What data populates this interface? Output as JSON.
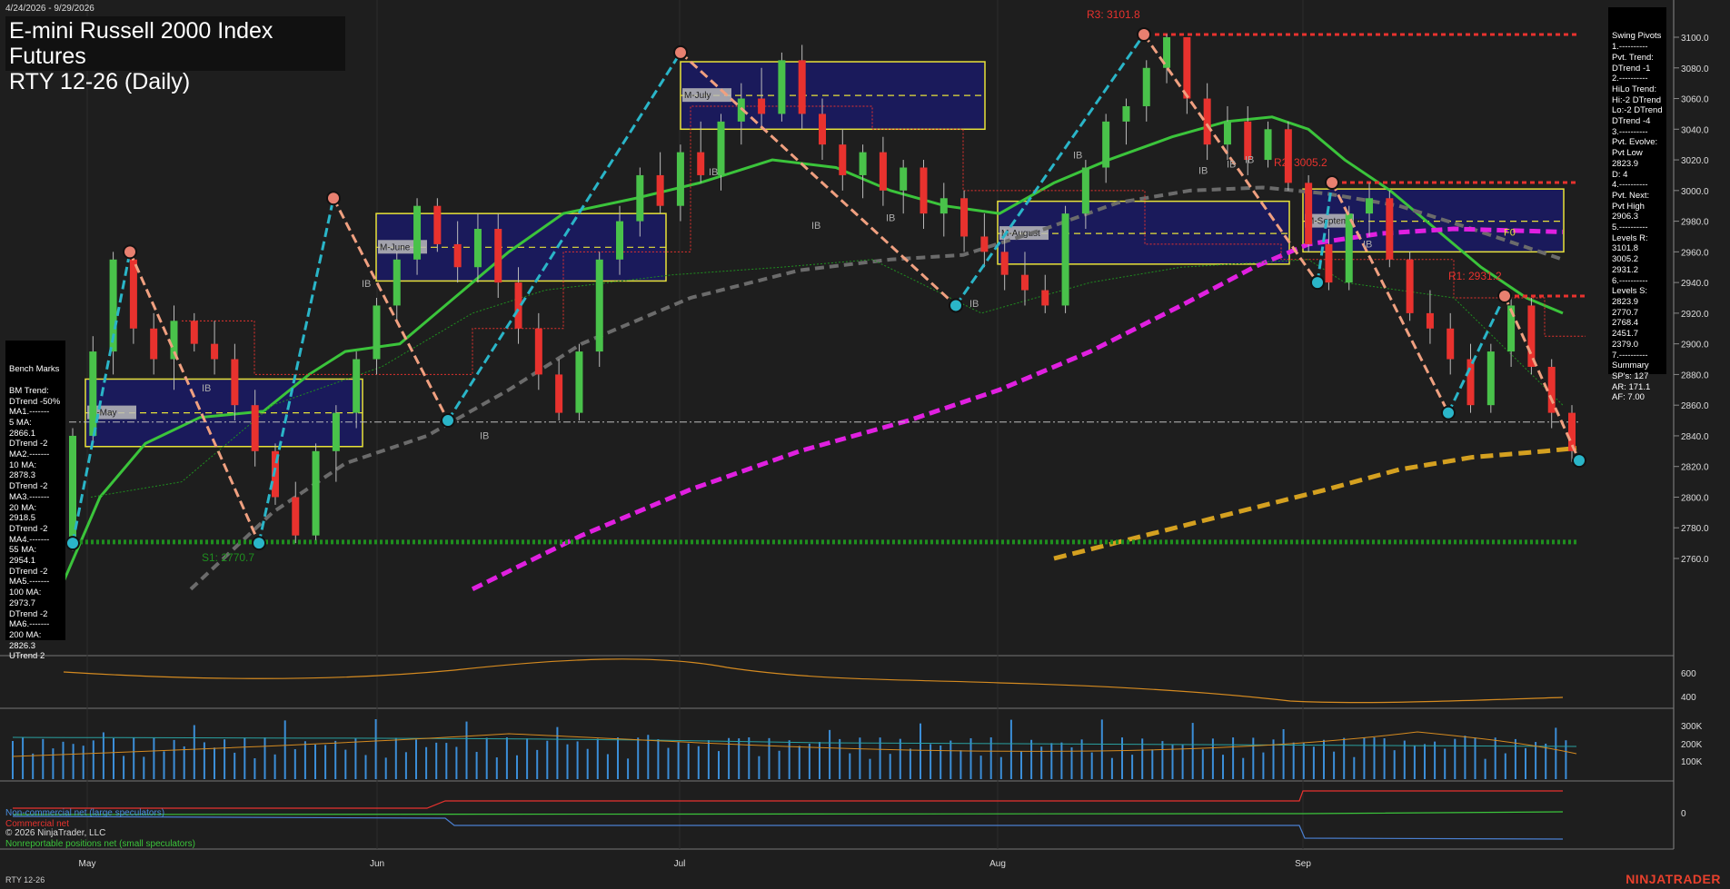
{
  "date_range": "4/24/2026 - 9/29/2026",
  "title": "E-mini Russell 2000 Index Futures",
  "subtitle": "RTY 12-26 (Daily)",
  "right_panel": {
    "lines": [
      "Swing Pivots",
      "1.----------",
      "Pvt. Trend:",
      "DTrend -1",
      "2.----------",
      "HiLo Trend:",
      "Hi:-2 DTrend",
      "Lo:-2 DTrend",
      "DTrend -4",
      "3.----------",
      "Pvt. Evolve:",
      "Pvt Low",
      "2823.9",
      "D: 4",
      "4.----------",
      "Pvt. Next:",
      "Pvt High",
      "2906.3",
      "5.----------",
      "Levels R:",
      "3101.8",
      "3005.2",
      "2931.2",
      "6.----------",
      "Levels S:",
      "2823.9",
      "2770.7",
      "2768.4",
      "2451.7",
      "2379.0",
      "7.----------",
      "Summary",
      "SP's: 127",
      "AR: 171.1",
      "AF: 7.00"
    ]
  },
  "left_panel": {
    "lines": [
      "Bench Marks",
      "",
      "BM Trend:",
      "DTrend -50%",
      "MA1.-------",
      "5 MA:",
      "2866.1",
      "DTrend -2",
      "MA2.-------",
      "10 MA:",
      "2878.3",
      "DTrend -2",
      "MA3.-------",
      "20 MA:",
      "2918.5",
      "DTrend -2",
      "MA4.-------",
      "55 MA:",
      "2954.1",
      "DTrend -2",
      "MA5.-------",
      "100 MA:",
      "2973.7",
      "DTrend -2",
      "MA6.-------",
      "200 MA:",
      "2826.3",
      "UTrend 2"
    ]
  },
  "levels": {
    "r3": "R3: 3101.8",
    "r2": "R2: 3005.2",
    "r1": "R1: 2931.2",
    "s1": "S1: 2770.7"
  },
  "box_labels": [
    "M-May",
    "M-June",
    "M-July",
    "M-August",
    "M-September"
  ],
  "ib_label": "IB",
  "fib_label": "F0",
  "x_labels": [
    "May",
    "Jun",
    "Jul",
    "Aug",
    "Sep"
  ],
  "y_ticks": [
    "3100.0",
    "3080.0",
    "3060.0",
    "3040.0",
    "3020.0",
    "3000.0",
    "2980.0",
    "2960.0",
    "2940.0",
    "2920.0",
    "2900.0",
    "2880.0",
    "2860.0",
    "2840.0",
    "2820.0",
    "2800.0",
    "2780.0",
    "2760.0"
  ],
  "osc_ticks": [
    "600",
    "400"
  ],
  "vol_ticks": [
    "300K",
    "200K",
    "100K"
  ],
  "cot_ticks": [
    "0"
  ],
  "cot_legend": {
    "noncommercial": "Non-commercial net (large speculators)",
    "commercial": "Commercial net",
    "nonreportable": "Nonreportable positions net (small speculators)"
  },
  "copyright": "© 2026 NinjaTrader, LLC",
  "instrument": "RTY 12-26",
  "brand": "NINJATRADER",
  "colors": {
    "up": "#49c24a",
    "down": "#e8322e",
    "ma_green": "#3bc43b",
    "ma_magenta": "#e020e0",
    "ma_gray": "#6b6b6b",
    "ma_gold": "#d4a020",
    "swing_up": "#2ab5c8",
    "swing_down": "#f0a080",
    "box_fill": "#1a1a66",
    "box_edge": "#e8e23a",
    "resistance": "#e8322e",
    "support": "#1f8f1f"
  },
  "chart_data": {
    "type": "candlestick",
    "title": "E-mini Russell 2000 Index Futures",
    "subtitle": "RTY 12-26 (Daily)",
    "ylim": [
      2750,
      3115
    ],
    "x": [
      "May",
      "Jun",
      "Jul",
      "Aug",
      "Sep"
    ],
    "ohlc": [
      [
        2770,
        2845,
        2765,
        2840
      ],
      [
        2840,
        2905,
        2835,
        2895
      ],
      [
        2895,
        2960,
        2880,
        2955
      ],
      [
        2955,
        2960,
        2900,
        2910
      ],
      [
        2910,
        2920,
        2880,
        2890
      ],
      [
        2890,
        2925,
        2870,
        2915
      ],
      [
        2915,
        2920,
        2895,
        2900
      ],
      [
        2900,
        2915,
        2880,
        2890
      ],
      [
        2890,
        2900,
        2850,
        2860
      ],
      [
        2860,
        2870,
        2820,
        2830
      ],
      [
        2830,
        2835,
        2795,
        2800
      ],
      [
        2800,
        2810,
        2770,
        2775
      ],
      [
        2775,
        2835,
        2772,
        2830
      ],
      [
        2830,
        2860,
        2810,
        2855
      ],
      [
        2855,
        2895,
        2845,
        2890
      ],
      [
        2890,
        2930,
        2880,
        2925
      ],
      [
        2925,
        2960,
        2915,
        2955
      ],
      [
        2955,
        2995,
        2945,
        2990
      ],
      [
        2990,
        2995,
        2960,
        2965
      ],
      [
        2965,
        2980,
        2940,
        2950
      ],
      [
        2950,
        2985,
        2940,
        2975
      ],
      [
        2975,
        2985,
        2930,
        2940
      ],
      [
        2940,
        2950,
        2900,
        2910
      ],
      [
        2910,
        2920,
        2870,
        2880
      ],
      [
        2880,
        2890,
        2850,
        2855
      ],
      [
        2855,
        2900,
        2850,
        2895
      ],
      [
        2895,
        2960,
        2885,
        2955
      ],
      [
        2955,
        2990,
        2945,
        2980
      ],
      [
        2980,
        3015,
        2970,
        3010
      ],
      [
        3010,
        3025,
        2985,
        2990
      ],
      [
        2990,
        3030,
        2980,
        3025
      ],
      [
        3025,
        3045,
        3005,
        3010
      ],
      [
        3010,
        3050,
        3000,
        3045
      ],
      [
        3045,
        3070,
        3030,
        3060
      ],
      [
        3060,
        3080,
        3040,
        3050
      ],
      [
        3050,
        3090,
        3045,
        3085
      ],
      [
        3085,
        3095,
        3040,
        3050
      ],
      [
        3050,
        3060,
        3020,
        3030
      ],
      [
        3030,
        3040,
        3000,
        3010
      ],
      [
        3010,
        3030,
        2995,
        3025
      ],
      [
        3025,
        3035,
        2990,
        3000
      ],
      [
        3000,
        3020,
        2985,
        3015
      ],
      [
        3015,
        3020,
        2975,
        2985
      ],
      [
        2985,
        3005,
        2970,
        2995
      ],
      [
        2995,
        3000,
        2960,
        2970
      ],
      [
        2970,
        2985,
        2950,
        2960
      ],
      [
        2960,
        2975,
        2935,
        2945
      ],
      [
        2945,
        2960,
        2925,
        2935
      ],
      [
        2935,
        2945,
        2920,
        2925
      ],
      [
        2925,
        2990,
        2920,
        2985
      ],
      [
        2985,
        3020,
        2975,
        3015
      ],
      [
        3015,
        3050,
        3005,
        3045
      ],
      [
        3045,
        3060,
        3030,
        3055
      ],
      [
        3055,
        3085,
        3045,
        3080
      ],
      [
        3080,
        3102,
        3070,
        3100
      ],
      [
        3100,
        3100,
        3050,
        3060
      ],
      [
        3060,
        3070,
        3020,
        3030
      ],
      [
        3030,
        3055,
        3020,
        3045
      ],
      [
        3045,
        3055,
        3010,
        3020
      ],
      [
        3020,
        3045,
        3015,
        3040
      ],
      [
        3040,
        3045,
        3000,
        3005
      ],
      [
        3005,
        3010,
        2960,
        2965
      ],
      [
        2965,
        2975,
        2935,
        2940
      ],
      [
        2940,
        2990,
        2935,
        2985
      ],
      [
        2985,
        3005,
        2970,
        2995
      ],
      [
        2995,
        3000,
        2950,
        2955
      ],
      [
        2955,
        2960,
        2915,
        2920
      ],
      [
        2920,
        2935,
        2900,
        2910
      ],
      [
        2910,
        2920,
        2880,
        2890
      ],
      [
        2890,
        2900,
        2855,
        2860
      ],
      [
        2860,
        2900,
        2855,
        2895
      ],
      [
        2895,
        2931,
        2885,
        2925
      ],
      [
        2925,
        2930,
        2880,
        2885
      ],
      [
        2885,
        2890,
        2845,
        2855
      ],
      [
        2855,
        2860,
        2823,
        2830
      ]
    ],
    "levels": [
      {
        "name": "R3",
        "value": 3101.8
      },
      {
        "name": "R2",
        "value": 3005.2
      },
      {
        "name": "R1",
        "value": 2931.2
      },
      {
        "name": "S1",
        "value": 2770.7
      }
    ],
    "moving_averages": [
      {
        "name": "5 MA",
        "value": 2866.1
      },
      {
        "name": "10 MA",
        "value": 2878.3
      },
      {
        "name": "20 MA",
        "value": 2918.5
      },
      {
        "name": "55 MA",
        "value": 2954.1
      },
      {
        "name": "100 MA",
        "value": 2973.7
      },
      {
        "name": "200 MA",
        "value": 2826.3
      }
    ],
    "swing_pivots": [
      2770,
      2960,
      2770,
      2995,
      2850,
      3090,
      2925,
      3101.8,
      2940,
      3005.2,
      2855,
      2931.2,
      2823.9
    ]
  }
}
